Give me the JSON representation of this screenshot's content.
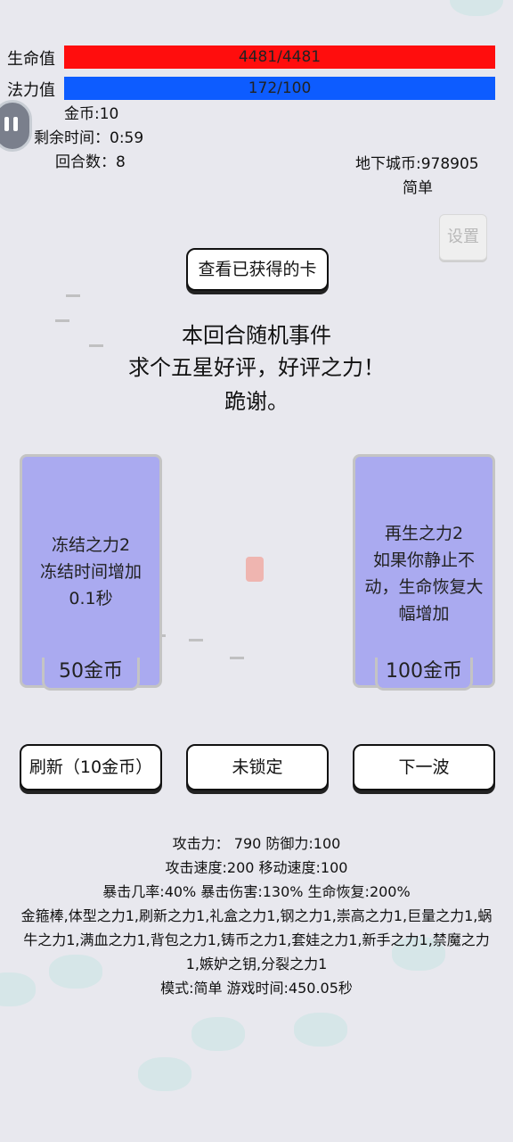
{
  "hud": {
    "hp_label": "生命值",
    "hp_value": "4481/4481",
    "mp_label": "法力值",
    "mp_value": "172/100",
    "gold": "金币:10",
    "time_left": "剩余时间：0:59",
    "round": "回合数：8",
    "dungeon_coins": "地下城币:978905",
    "difficulty": "简单"
  },
  "buttons": {
    "settings": "设置",
    "view_cards": "查看已获得的卡",
    "refresh": "刷新（10金币）",
    "lock": "未锁定",
    "next_wave": "下一波"
  },
  "event": {
    "line1": "本回合随机事件",
    "line2": "求个五星好评，好评之力！",
    "line3": "跪谢。"
  },
  "cards": [
    {
      "name": "冻结之力2",
      "desc1": "冻结时间增加",
      "desc2": "0.1秒",
      "price": "50金币"
    },
    {
      "name": "再生之力2",
      "desc1": "如果你静止不",
      "desc2": "动，生命恢复大",
      "desc3": "幅增加",
      "price": "100金币"
    }
  ],
  "stats": {
    "line1": "攻击力： 790 防御力:100",
    "line2": "攻击速度:200 移动速度:100",
    "line3": "暴击几率:40% 暴击伤害:130% 生命恢复:200%",
    "items": "金箍棒,体型之力1,刷新之力1,礼盒之力1,钢之力1,崇高之力1,巨量之力1,蜗牛之力1,满血之力1,背包之力1,铸币之力1,套娃之力1,新手之力1,禁魔之力1,嫉妒之钥,分裂之力1",
    "mode": "模式:简单 游戏时间:450.05秒"
  },
  "colors": {
    "hp": "#ff0d0d",
    "mp": "#0d5cff",
    "card": "#aaaaf0"
  }
}
